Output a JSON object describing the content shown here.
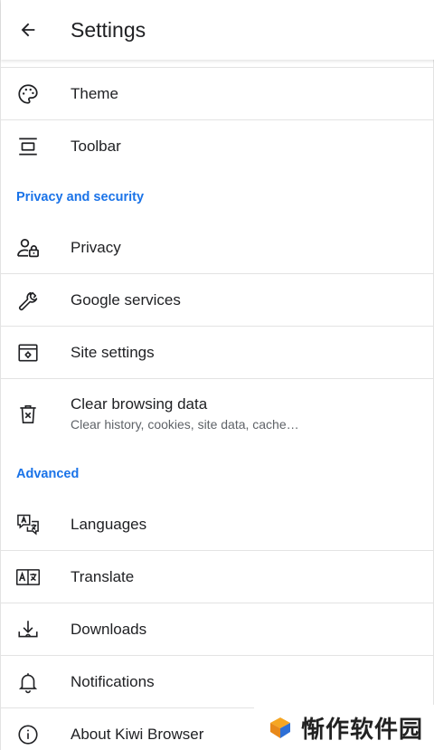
{
  "app_bar": {
    "title": "Settings"
  },
  "rows": {
    "theme": "Theme",
    "toolbar": "Toolbar",
    "privacy": "Privacy",
    "google_services": "Google services",
    "site_settings": "Site settings",
    "clear_browsing_data": "Clear browsing data",
    "clear_browsing_data_summary": "Clear history, cookies, site data, cache…",
    "languages": "Languages",
    "translate": "Translate",
    "downloads": "Downloads",
    "notifications": "Notifications",
    "about": "About Kiwi Browser"
  },
  "sections": {
    "privacy_security": "Privacy and security",
    "advanced": "Advanced"
  },
  "watermark": {
    "text": "惭作软件园"
  },
  "icons": {
    "back": "arrow-back-icon",
    "theme": "palette-icon",
    "toolbar": "toolbar-icon",
    "privacy": "privacy-user-lock-icon",
    "google_services": "wrench-icon",
    "site_settings": "site-settings-icon",
    "clear_browsing_data": "trash-x-icon",
    "languages": "languages-icon",
    "translate": "translate-icon",
    "downloads": "download-icon",
    "notifications": "bell-icon",
    "about": "info-icon"
  },
  "colors": {
    "accent": "#1a73e8",
    "text": "#202124",
    "divider": "#e3e3e3"
  }
}
